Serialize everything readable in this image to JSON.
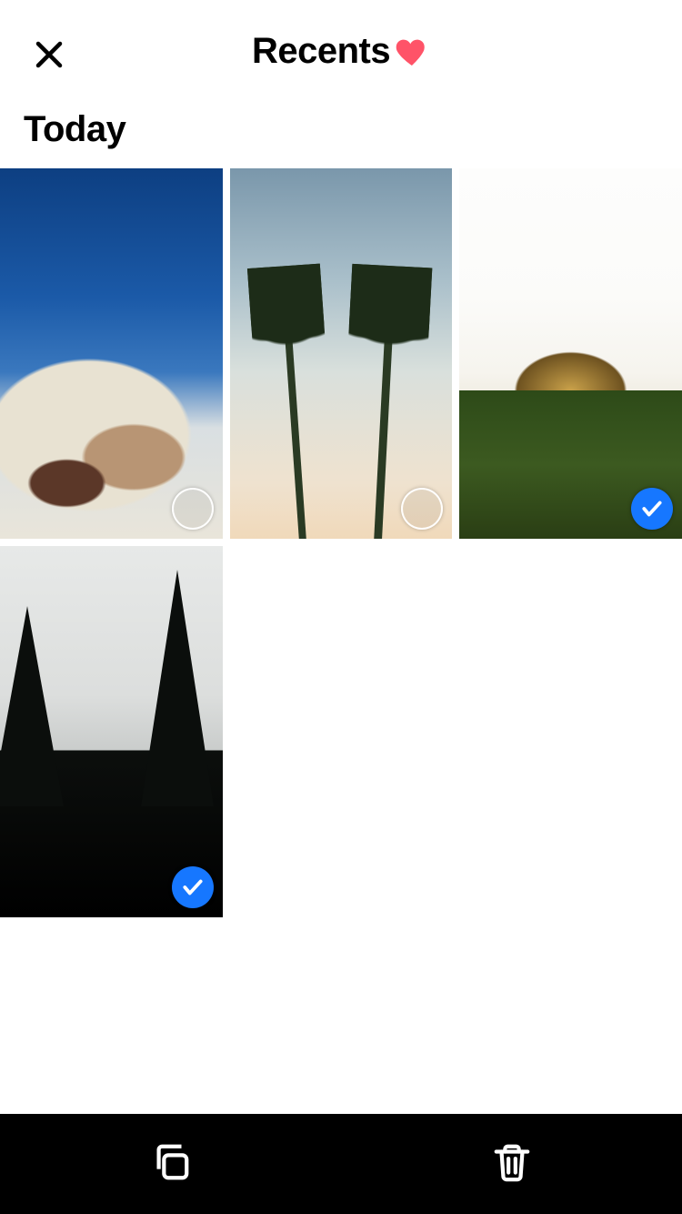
{
  "header": {
    "title": "Recents",
    "close_icon": "close-icon",
    "favorite_icon": "heart-icon",
    "colors": {
      "heart": "#ff5368",
      "accent": "#1677ff"
    }
  },
  "section": {
    "label": "Today"
  },
  "photos": [
    {
      "name": "photo-clouds",
      "selected": false
    },
    {
      "name": "photo-palms",
      "selected": false
    },
    {
      "name": "photo-canoe",
      "selected": true
    },
    {
      "name": "photo-pines",
      "selected": true
    }
  ],
  "toolbar": {
    "copy_icon": "copy-icon",
    "delete_icon": "trash-icon"
  }
}
